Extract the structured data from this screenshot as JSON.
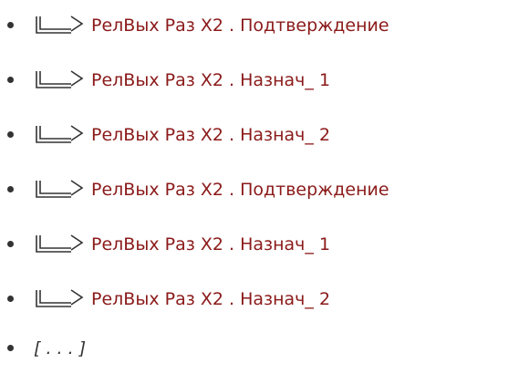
{
  "items": [
    {
      "label": "РелВых Раз X2 . Подтверждение",
      "icon": "double-line-right-arrow-icon"
    },
    {
      "label": "РелВых Раз X2 . Назнач_ 1",
      "icon": "double-line-right-arrow-icon"
    },
    {
      "label": "РелВых Раз X2 . Назнач_ 2",
      "icon": "double-line-right-arrow-icon"
    },
    {
      "label": "РелВых Раз X2 . Подтверждение",
      "icon": "double-line-right-arrow-icon"
    },
    {
      "label": "РелВых Раз X2 . Назнач_ 1",
      "icon": "double-line-right-arrow-icon"
    },
    {
      "label": "РелВых Раз X2 . Назнач_ 2",
      "icon": "double-line-right-arrow-icon"
    }
  ],
  "more": "[ . . . ]",
  "colors": {
    "link": "#8b1a1a",
    "text": "#333333",
    "background": "#ffffff"
  }
}
